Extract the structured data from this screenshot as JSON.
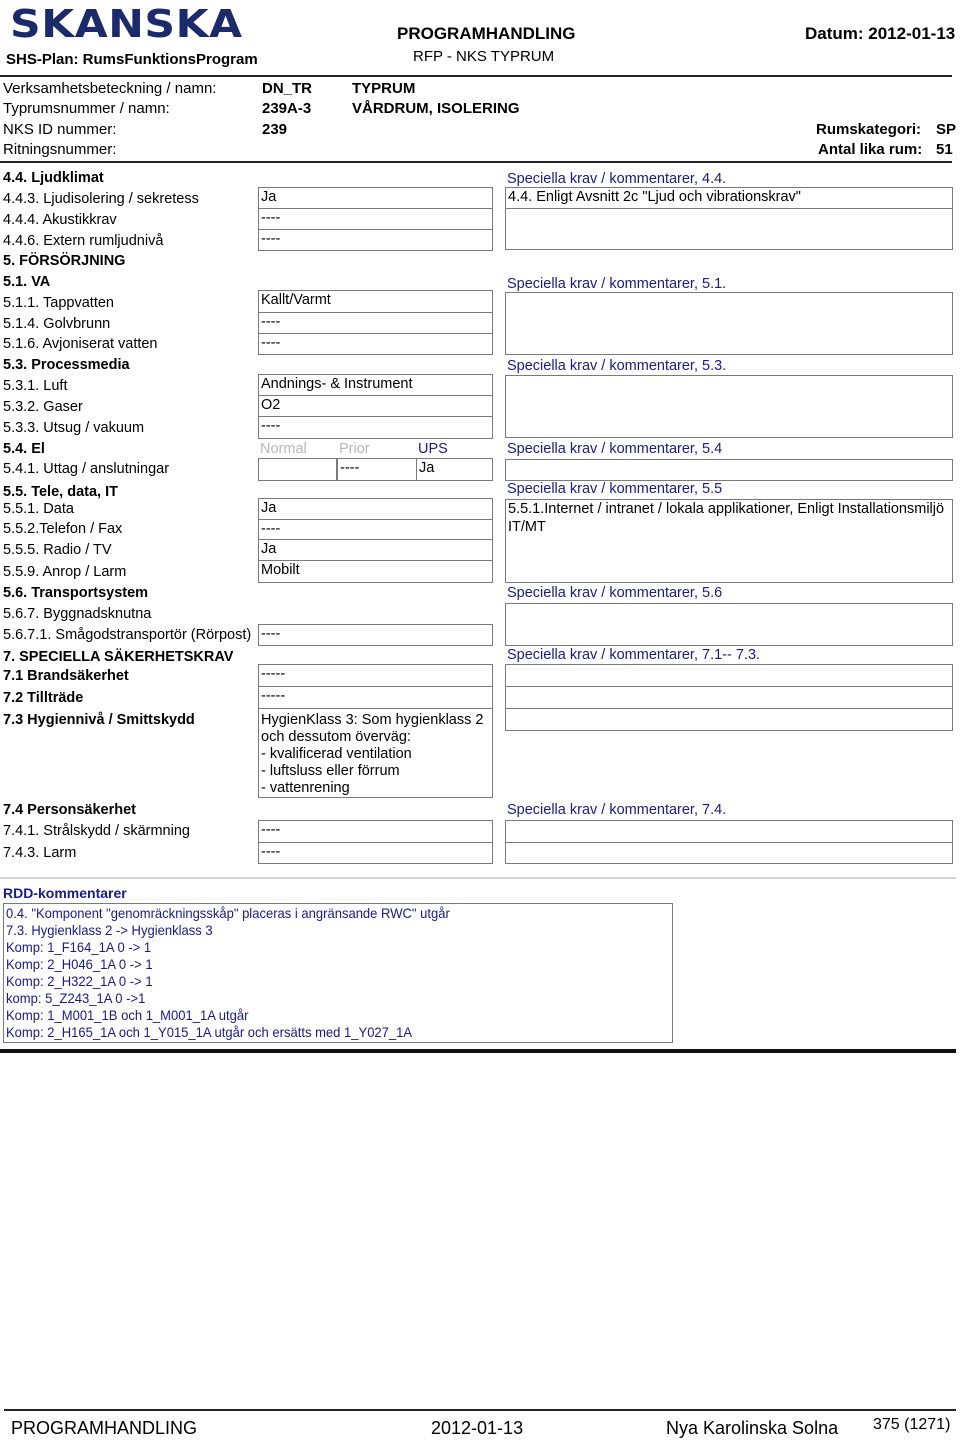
{
  "header": {
    "logo": "SKANSKA",
    "plan": "SHS-Plan: RumsFunktionsProgram",
    "title": "PROGRAMHANDLING",
    "subtitle": "RFP -  NKS TYPRUM",
    "date": "Datum: 2012-01-13"
  },
  "info": {
    "rows": [
      {
        "label": "Verksamhetsbeteckning / namn:",
        "code": "DN_TR",
        "name": "TYPRUM"
      },
      {
        "label": "Typrumsnummer / namn:",
        "code": "239A-3",
        "name": "VÅRDRUM, ISOLERING"
      },
      {
        "label": "NKS ID nummer:",
        "code": "239",
        "name": ""
      },
      {
        "label": "Ritningsnummer:",
        "code": "",
        "name": ""
      }
    ],
    "rumskategori_label": "Rumskategori:",
    "rumskategori_value": "SP",
    "antal_label": "Antal lika rum:",
    "antal_value": "51"
  },
  "sections": {
    "s44": {
      "title": "4.4. Ljudklimat",
      "items": [
        {
          "label": "4.4.3. Ljudisolering / sekretess",
          "value": "Ja"
        },
        {
          "label": "4.4.4. Akustikkrav",
          "value": "----"
        },
        {
          "label": "4.4.6. Extern rumljudnivå",
          "value": "----"
        }
      ],
      "comment_label": "Speciella krav / kommentarer, 4.4.",
      "comment_lines": [
        "4.4. Enligt Avsnitt 2c \"Ljud och vibrationskrav\"",
        ""
      ]
    },
    "s5": {
      "title": "5. FÖRSÖRJNING"
    },
    "s51": {
      "title": "5.1. VA",
      "items": [
        {
          "label": "5.1.1. Tappvatten",
          "value": "Kallt/Varmt"
        },
        {
          "label": "5.1.4. Golvbrunn",
          "value": "----"
        },
        {
          "label": "5.1.6. Avjoniserat vatten",
          "value": "----"
        }
      ],
      "comment_label": "Speciella krav / kommentarer, 5.1.",
      "comment_text": ""
    },
    "s53": {
      "title": "5.3. Processmedia",
      "items": [
        {
          "label": "5.3.1. Luft",
          "value": "Andnings- & Instrument"
        },
        {
          "label": "5.3.2. Gaser",
          "value": "O2"
        },
        {
          "label": "5.3.3. Utsug / vakuum",
          "value": "----"
        }
      ],
      "comment_label": "Speciella krav / kommentarer, 5.3.",
      "comment_text": ""
    },
    "s54": {
      "title": "5.4. El",
      "columns": [
        "Normal",
        "Prior",
        "UPS"
      ],
      "item_label": "5.4.1. Uttag / anslutningar",
      "values": [
        "",
        "----",
        "Ja"
      ],
      "comment_label": "Speciella krav / kommentarer, 5.4",
      "comment_text": ""
    },
    "s55": {
      "title": "5.5. Tele, data, IT",
      "items": [
        {
          "label": "5.5.1. Data",
          "value": "Ja"
        },
        {
          "label": "5.5.2.Telefon / Fax",
          "value": "----"
        },
        {
          "label": "5.5.5. Radio / TV",
          "value": "Ja"
        },
        {
          "label": "5.5.9. Anrop / Larm",
          "value": "Mobilt"
        }
      ],
      "comment_label": "Speciella krav / kommentarer, 5.5",
      "comment_line1": "5.5.1.Internet / intranet / lokala applikationer, Enligt Installationsmiljö",
      "comment_line2": "IT/MT"
    },
    "s56": {
      "title": "5.6. Transportsystem",
      "sub_title": "5.6.7. Byggnadsknutna",
      "items": [
        {
          "label": "5.6.7.1. Smågodstransportör (Rörpost)",
          "value": "----"
        }
      ],
      "comment_label": "Speciella krav / kommentarer,  5.6",
      "comment_text": ""
    },
    "s7": {
      "title": "7. SPECIELLA SÄKERHETSKRAV",
      "items": [
        {
          "label": "7.1 Brandsäkerhet",
          "value": "-----"
        },
        {
          "label": "7.2 Tillträde",
          "value": "-----"
        },
        {
          "label": "7.3 Hygiennivå / Smittskydd",
          "value_lines": [
            "HygienKlass 3: Som hygienklass 2",
            "och dessutom överväg:",
            "- kvalificerad ventilation",
            "- luftsluss eller förrum",
            "- vattenrening"
          ]
        }
      ],
      "comment_label": "Speciella krav / kommentarer, 7.1-- 7.3."
    },
    "s74": {
      "title": "7.4 Personsäkerhet",
      "items": [
        {
          "label": "7.4.1. Strålskydd / skärmning",
          "value": "----"
        },
        {
          "label": "7.4.3. Larm",
          "value": "----"
        }
      ],
      "comment_label": "Speciella krav / kommentarer, 7.4."
    }
  },
  "rdd": {
    "title": "RDD-kommentarer",
    "lines": [
      "0.4. \"Komponent \"genomräckningsskåp\" placeras i angränsande RWC\" utgår",
      "7.3. Hygienklass 2 -> Hygienklass 3",
      "Komp: 1_F164_1A 0 -> 1",
      "Komp: 2_H046_1A 0 -> 1",
      "Komp: 2_H322_1A 0 -> 1",
      "komp: 5_Z243_1A 0 ->1",
      "Komp: 1_M001_1B och 1_M001_1A utgår",
      "Komp: 2_H165_1A och 1_Y015_1A utgår och ersätts med 1_Y027_1A"
    ]
  },
  "footer": {
    "doc": "PROGRAMHANDLING",
    "date": "2012-01-13",
    "project": "Nya Karolinska Solna",
    "page": "375 (1271)"
  },
  "colors": {
    "brand": "#1b2a6b",
    "accent_blue": "#1a1a8c",
    "muted": "#b8b8b8"
  }
}
